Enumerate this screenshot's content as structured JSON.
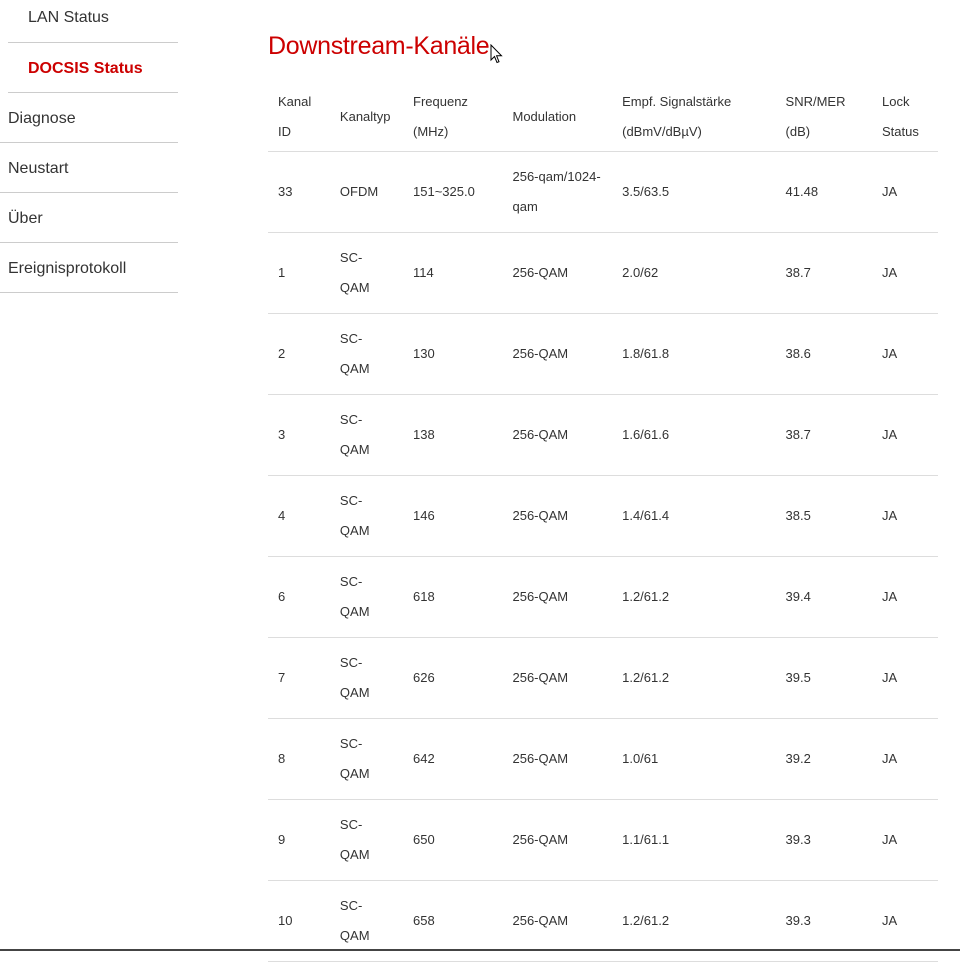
{
  "sidebar": {
    "items": [
      {
        "label": "LAN Status"
      },
      {
        "label": "DOCSIS Status"
      },
      {
        "label": "Diagnose"
      },
      {
        "label": "Neustart"
      },
      {
        "label": "Über"
      },
      {
        "label": "Ereignisprotokoll"
      }
    ]
  },
  "main": {
    "title": "Downstream-Kanäle",
    "table": {
      "headers": {
        "kanal_id_1": "Kanal",
        "kanal_id_2": "ID",
        "kanaltyp": "Kanaltyp",
        "frequenz_1": "Frequenz",
        "frequenz_2": "(MHz)",
        "modulation": "Modulation",
        "signal_1": "Empf. Signalstärke",
        "signal_2": "(dBmV/dBµV)",
        "snr_1": "SNR/MER",
        "snr_2": "(dB)",
        "lock_1": "Lock",
        "lock_2": "Status"
      },
      "rows": [
        {
          "id": "33",
          "type1": "OFDM",
          "type2": "",
          "freq": "151~325.0",
          "mod1": "256-qam/1024-",
          "mod2": "qam",
          "signal": "3.5/63.5",
          "snr": "41.48",
          "lock": "JA"
        },
        {
          "id": "1",
          "type1": "SC-",
          "type2": "QAM",
          "freq": "114",
          "mod1": "256-QAM",
          "mod2": "",
          "signal": "2.0/62",
          "snr": "38.7",
          "lock": "JA"
        },
        {
          "id": "2",
          "type1": "SC-",
          "type2": "QAM",
          "freq": "130",
          "mod1": "256-QAM",
          "mod2": "",
          "signal": "1.8/61.8",
          "snr": "38.6",
          "lock": "JA"
        },
        {
          "id": "3",
          "type1": "SC-",
          "type2": "QAM",
          "freq": "138",
          "mod1": "256-QAM",
          "mod2": "",
          "signal": "1.6/61.6",
          "snr": "38.7",
          "lock": "JA"
        },
        {
          "id": "4",
          "type1": "SC-",
          "type2": "QAM",
          "freq": "146",
          "mod1": "256-QAM",
          "mod2": "",
          "signal": "1.4/61.4",
          "snr": "38.5",
          "lock": "JA"
        },
        {
          "id": "6",
          "type1": "SC-",
          "type2": "QAM",
          "freq": "618",
          "mod1": "256-QAM",
          "mod2": "",
          "signal": "1.2/61.2",
          "snr": "39.4",
          "lock": "JA"
        },
        {
          "id": "7",
          "type1": "SC-",
          "type2": "QAM",
          "freq": "626",
          "mod1": "256-QAM",
          "mod2": "",
          "signal": "1.2/61.2",
          "snr": "39.5",
          "lock": "JA"
        },
        {
          "id": "8",
          "type1": "SC-",
          "type2": "QAM",
          "freq": "642",
          "mod1": "256-QAM",
          "mod2": "",
          "signal": "1.0/61",
          "snr": "39.2",
          "lock": "JA"
        },
        {
          "id": "9",
          "type1": "SC-",
          "type2": "QAM",
          "freq": "650",
          "mod1": "256-QAM",
          "mod2": "",
          "signal": "1.1/61.1",
          "snr": "39.3",
          "lock": "JA"
        },
        {
          "id": "10",
          "type1": "SC-",
          "type2": "QAM",
          "freq": "658",
          "mod1": "256-QAM",
          "mod2": "",
          "signal": "1.2/61.2",
          "snr": "39.3",
          "lock": "JA"
        }
      ]
    }
  },
  "colors": {
    "accent": "#cc0000",
    "text": "#333333",
    "divider": "#dddddd"
  },
  "icons": {
    "cursor": "mouse-pointer-icon"
  }
}
